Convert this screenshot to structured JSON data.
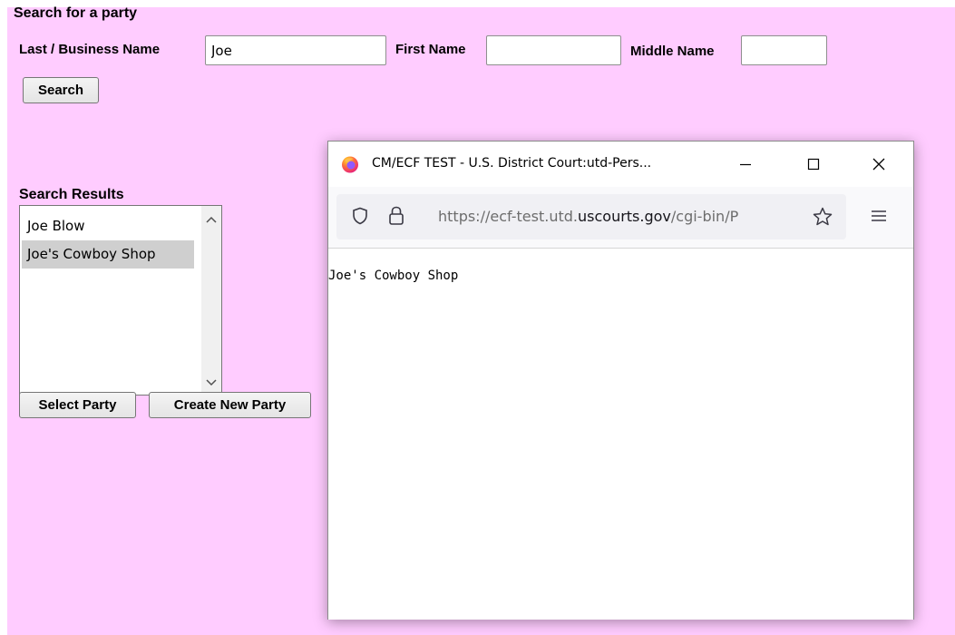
{
  "form": {
    "heading": "Search for a party",
    "last_name_label": "Last / Business Name",
    "last_name_value": "Joe",
    "first_name_label": "First Name",
    "first_name_value": "",
    "middle_name_label": "Middle Name",
    "middle_name_value": "",
    "search_button": "Search"
  },
  "results": {
    "heading": "Search Results",
    "items": [
      {
        "label": "Joe Blow",
        "selected": false
      },
      {
        "label": "Joe's Cowboy Shop",
        "selected": true
      }
    ],
    "select_party_button": "Select Party",
    "create_new_party_button": "Create New Party"
  },
  "popup": {
    "title": "CM/ECF TEST - U.S. District Court:utd-Pers...",
    "url_prefix": "https://ecf-test.utd.",
    "url_domain": "uscourts.gov",
    "url_suffix": "/cgi-bin/P",
    "content_text": "Joe's Cowboy Shop"
  },
  "colors": {
    "page_background": "#ffccff",
    "selected_item": "#cfcfcf",
    "firefox_orange": "#ff7139",
    "firefox_purple": "#9059ff"
  },
  "icons": {
    "browser": "firefox-logo-icon",
    "minimize": "minimize-icon",
    "maximize": "maximize-icon",
    "close": "close-icon",
    "shield": "shield-icon",
    "lock": "lock-icon",
    "bookmark": "star-icon",
    "menu": "hamburger-menu-icon",
    "scroll_up": "chevron-up-icon",
    "scroll_down": "chevron-down-icon"
  }
}
